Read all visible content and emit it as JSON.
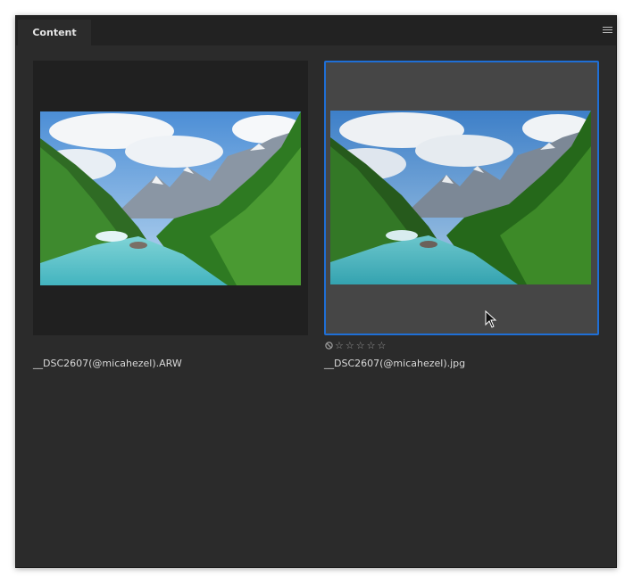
{
  "panel": {
    "tab_label": "Content",
    "menu_icon": "hamburger-menu-icon"
  },
  "items": [
    {
      "filename": "__DSC2607(@micahezel).ARW",
      "selected": false
    },
    {
      "filename": "__DSC2607(@micahezel).jpg",
      "selected": true,
      "rating": [
        "☆",
        "☆",
        "☆",
        "☆",
        "☆"
      ],
      "reject_icon": "reject-icon"
    }
  ],
  "colors": {
    "panel_bg": "#2b2b2b",
    "selection_border": "#1f6fd6",
    "selected_bg": "#464646"
  }
}
